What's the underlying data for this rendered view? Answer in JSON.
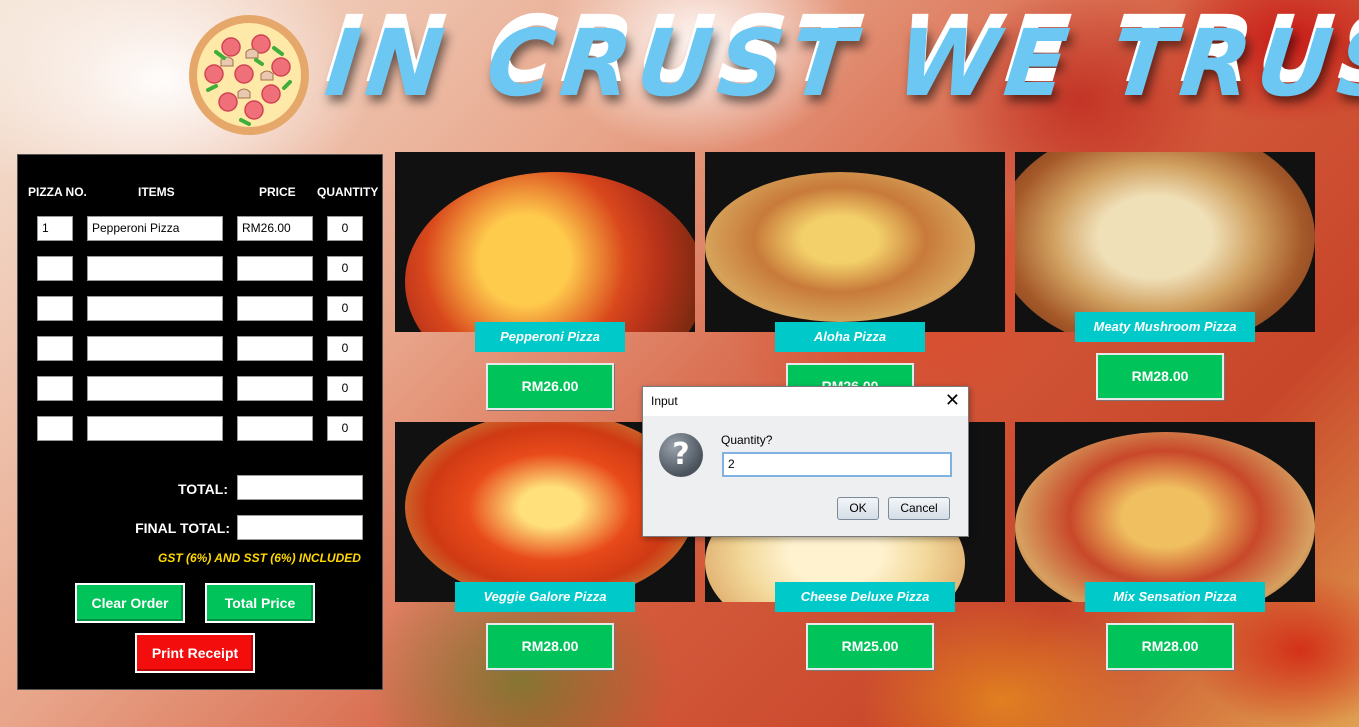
{
  "header": {
    "banner_text": "IN CRUST WE TRUST"
  },
  "order_panel": {
    "columns": [
      "PIZZA NO.",
      "ITEMS",
      "PRICE",
      "QUANTITY"
    ],
    "rows": [
      {
        "no": "1",
        "item": "Pepperoni Pizza",
        "price": "RM26.00",
        "qty": "0"
      },
      {
        "no": "",
        "item": "",
        "price": "",
        "qty": "0"
      },
      {
        "no": "",
        "item": "",
        "price": "",
        "qty": "0"
      },
      {
        "no": "",
        "item": "",
        "price": "",
        "qty": "0"
      },
      {
        "no": "",
        "item": "",
        "price": "",
        "qty": "0"
      },
      {
        "no": "",
        "item": "",
        "price": "",
        "qty": "0"
      }
    ],
    "total_label": "TOTAL:",
    "total_value": "",
    "final_total_label": "FINAL TOTAL:",
    "final_total_value": "",
    "tax_note": "GST (6%) AND SST (6%) INCLUDED",
    "clear_order": "Clear Order",
    "total_price": "Total Price",
    "print_receipt": "Print Receipt"
  },
  "menu": [
    {
      "name": "Pepperoni Pizza",
      "price": "RM26.00"
    },
    {
      "name": "Aloha Pizza",
      "price": "RM26.00"
    },
    {
      "name": "Meaty Mushroom Pizza",
      "price": "RM28.00"
    },
    {
      "name": "Veggie Galore Pizza",
      "price": "RM28.00"
    },
    {
      "name": "Cheese Deluxe Pizza",
      "price": "RM25.00"
    },
    {
      "name": "Mix Sensation Pizza",
      "price": "RM28.00"
    }
  ],
  "dialog": {
    "title": "Input",
    "prompt": "Quantity?",
    "value": "2",
    "ok": "OK",
    "cancel": "Cancel",
    "close_icon": "close-icon",
    "icon": "question-icon"
  },
  "colors": {
    "accent_green": "#00c35a",
    "accent_cyan": "#00c9c9",
    "accent_red": "#f30d0d",
    "tax_note_yellow": "#ffd800",
    "banner_blue": "#6cc7f2"
  }
}
